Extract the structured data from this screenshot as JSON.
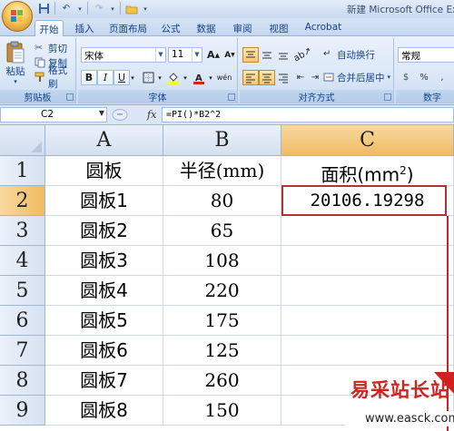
{
  "window": {
    "title": "新建 Microsoft Office Ex"
  },
  "ribbon_tabs": [
    "开始",
    "插入",
    "页面布局",
    "公式",
    "数据",
    "审阅",
    "视图",
    "Acrobat"
  ],
  "clipboard": {
    "paste": "粘贴",
    "cut": "剪切",
    "copy": "复制",
    "format_painter": "格式刷",
    "group_label": "剪贴板"
  },
  "font": {
    "name": "宋体",
    "size": "11",
    "grow": "A",
    "shrink": "A",
    "bold": "B",
    "italic": "I",
    "underline": "U",
    "phonetic": "wén",
    "group_label": "字体"
  },
  "alignment": {
    "wrap_text": "自动换行",
    "merge_center": "合并后居中",
    "group_label": "对齐方式"
  },
  "number": {
    "format": "常规",
    "group_label": "数字"
  },
  "formula_bar": {
    "name_box": "C2",
    "fx": "fx",
    "formula": "=PI()*B2^2"
  },
  "sheet": {
    "columns": [
      "A",
      "B",
      "C"
    ],
    "rows": [
      "1",
      "2",
      "3",
      "4",
      "5",
      "6",
      "7",
      "8",
      "9"
    ],
    "header_row": {
      "a": "圆板",
      "b": "半径(mm)",
      "c_base": "面积(mm",
      "c_sup": "2",
      "c_close": ")"
    },
    "data": [
      {
        "a": "圆板1",
        "b": "80",
        "c": "20106.19298"
      },
      {
        "a": "圆板2",
        "b": "65",
        "c": ""
      },
      {
        "a": "圆板3",
        "b": "108",
        "c": ""
      },
      {
        "a": "圆板4",
        "b": "220",
        "c": ""
      },
      {
        "a": "圆板5",
        "b": "175",
        "c": ""
      },
      {
        "a": "圆板6",
        "b": "125",
        "c": ""
      },
      {
        "a": "圆板7",
        "b": "260",
        "c": ""
      },
      {
        "a": "圆板8",
        "b": "150",
        "c": ""
      }
    ]
  },
  "watermark": {
    "title": "易采站长站",
    "url": "www.easck.com"
  },
  "colors": {
    "accent_red": "#d0221c",
    "selected_header": "#f0bb62",
    "ribbon_blue": "#dbe7f7"
  }
}
